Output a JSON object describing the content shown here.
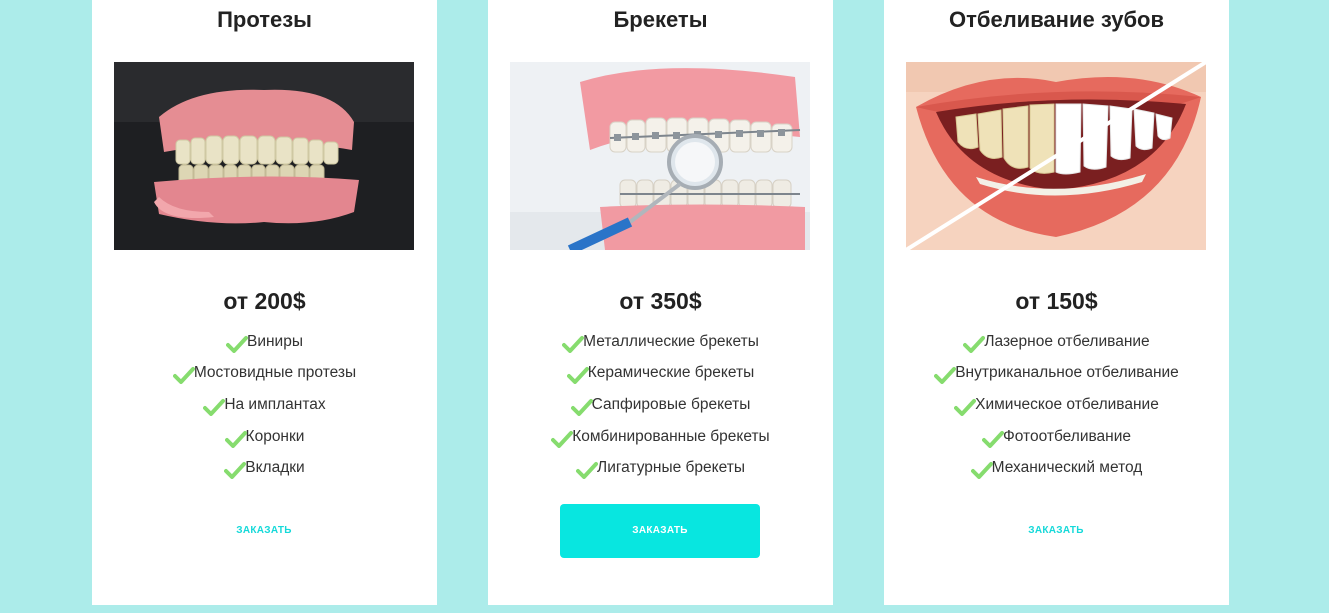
{
  "colors": {
    "background": "#acecea",
    "card": "#ffffff",
    "accent": "#08e6e0",
    "check": "#86dc6e"
  },
  "cards": [
    {
      "title": "Протезы",
      "image": "dentures-photo",
      "price": "от 200$",
      "features": [
        "Виниры",
        "Мостовидные протезы",
        "На имплантах",
        "Коронки",
        "Вкладки"
      ],
      "button": "ЗАКАЗАТЬ",
      "button_style": "text"
    },
    {
      "title": "Брекеты",
      "image": "braces-photo",
      "price": "от 350$",
      "features": [
        "Металлические брекеты",
        "Керамические брекеты",
        "Сапфировые брекеты",
        "Комбинированные брекеты",
        "Лигатурные брекеты"
      ],
      "button": "ЗАКАЗАТЬ",
      "button_style": "filled"
    },
    {
      "title": "Отбеливание зубов",
      "image": "whitening-photo",
      "price": "от 150$",
      "features": [
        "Лазерное отбеливание",
        "Внутриканальное отбеливание",
        "Химическое отбеливание",
        "Фотоотбеливание",
        "Механический метод"
      ],
      "button": "ЗАКАЗАТЬ",
      "button_style": "text"
    }
  ]
}
